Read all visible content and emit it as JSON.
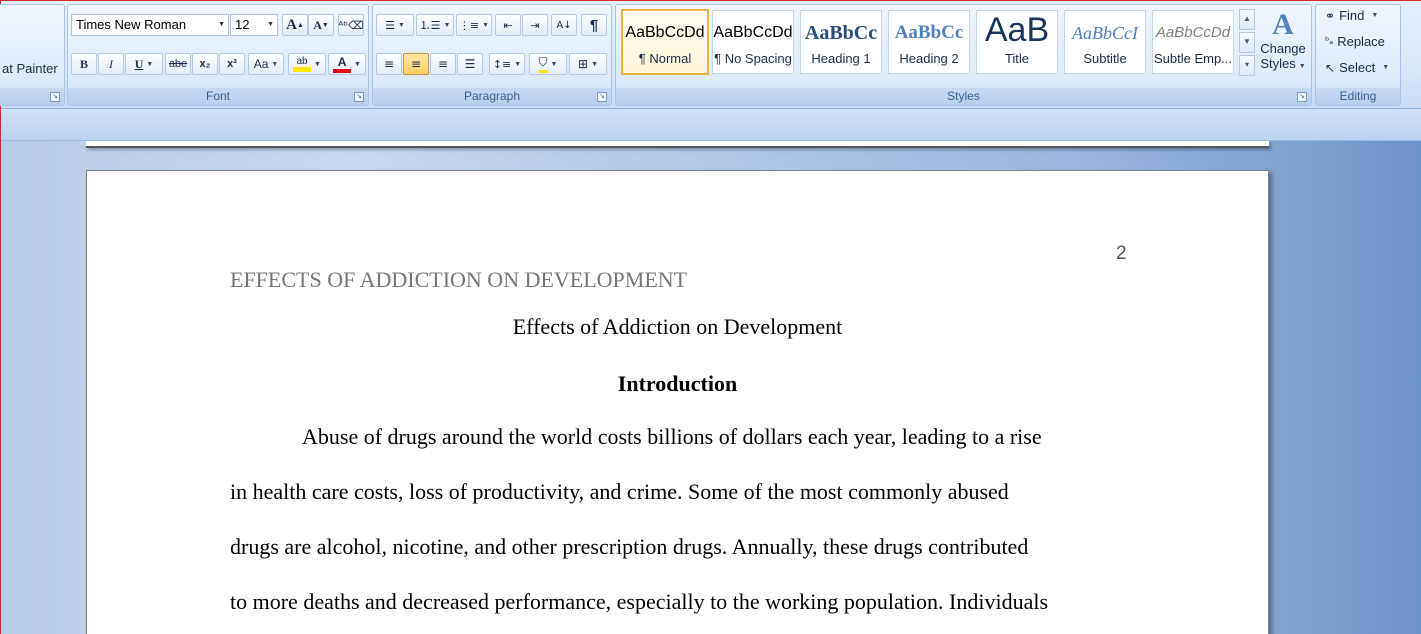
{
  "clipboard": {
    "format_painter_label": "at Painter"
  },
  "font": {
    "group_label": "Font",
    "font_name": "Times New Roman",
    "font_size": "12",
    "grow_label": "A",
    "shrink_label": "A",
    "bold_label": "B",
    "italic_label": "I",
    "underline_label": "U",
    "strike_label": "abe",
    "subscript_label": "x₂",
    "superscript_label": "x²",
    "case_label": "Aa",
    "highlight_label": "ab",
    "font_color_label": "A"
  },
  "paragraph": {
    "group_label": "Paragraph",
    "pilcrow": "¶"
  },
  "styles": {
    "group_label": "Styles",
    "tiles": [
      {
        "sample": "AaBbCcDd",
        "name": "¶ Normal"
      },
      {
        "sample": "AaBbCcDd",
        "name": "¶ No Spacing"
      },
      {
        "sample": "AaBbCc",
        "name": "Heading 1"
      },
      {
        "sample": "AaBbCc",
        "name": "Heading 2"
      },
      {
        "sample": "AaB",
        "name": "Title"
      },
      {
        "sample": "AaBbCcI",
        "name": "Subtitle"
      },
      {
        "sample": "AaBbCcDd",
        "name": "Subtle Emp..."
      }
    ],
    "change_styles_line1": "Change",
    "change_styles_line2": "Styles"
  },
  "editing": {
    "group_label": "Editing",
    "find_label": "Find",
    "replace_label": "Replace",
    "select_label": "Select"
  },
  "document": {
    "page_number": "2",
    "running_head": "EFFECTS OF  ADDICTION ON DEVELOPMENT",
    "title": "Effects of Addiction on Development",
    "heading": "Introduction",
    "lines": [
      "Abuse of drugs around the world costs billions of dollars each year, leading to a rise",
      "in health care costs, loss of productivity, and crime. Some of the most commonly abused",
      "drugs are alcohol, nicotine, and other prescription drugs.   Annually, these drugs contributed",
      "to more deaths and decreased performance, especially to the working population. Individuals"
    ]
  },
  "colors": {
    "accent_highlight": "#ffe600",
    "font_color_bar": "#e01010",
    "selected_style_border": "#e5b540"
  }
}
